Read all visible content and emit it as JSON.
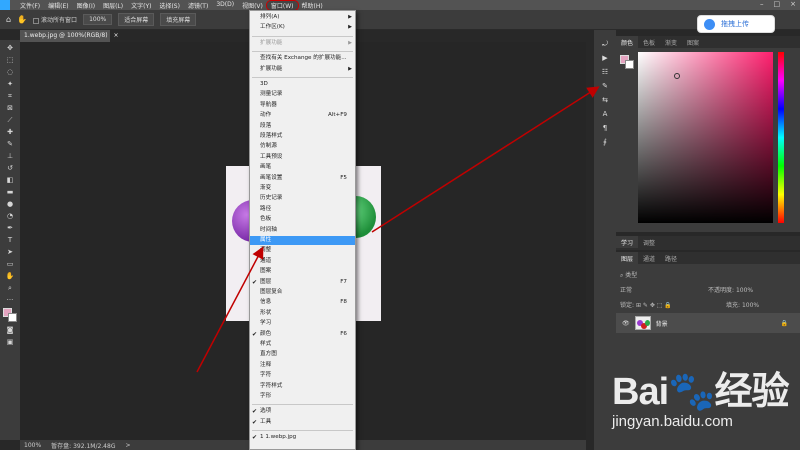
{
  "menubar": {
    "items": [
      "文件(F)",
      "编辑(E)",
      "图像(I)",
      "图层(L)",
      "文字(Y)",
      "选择(S)",
      "滤镜(T)",
      "3D(D)",
      "视图(V)",
      "窗口(W)",
      "帮助(H)"
    ],
    "active_index": 9
  },
  "options_bar": {
    "scroll_all_label": "滚动所有窗口",
    "zoom_value": "100%",
    "fit_screen": "适合屏幕",
    "fill_screen": "填充屏幕"
  },
  "document": {
    "tab_title": "1.webp.jpg @ 100%(RGB/8)",
    "close": "×"
  },
  "status": {
    "zoom": "100%",
    "scratch": "暂存盘: 392.1M/2.48G",
    "arrow": ">"
  },
  "upload_button": {
    "label": "拖拽上传"
  },
  "color_panel": {
    "tabs": [
      "颜色",
      "色板",
      "渐变",
      "图案"
    ]
  },
  "learn_panel": {
    "tabs": [
      "学习",
      "调整"
    ]
  },
  "layers_panel": {
    "tabs": [
      "图层",
      "通道",
      "路径"
    ],
    "kind_label": "类型",
    "blend_mode": "正常",
    "opacity_label": "不透明度:",
    "opacity_value": "100%",
    "lock_label": "锁定:",
    "fill_label": "填充:",
    "fill_value": "100%",
    "layer_name": "背景"
  },
  "window_menu": {
    "items": [
      {
        "label": "排列(A)",
        "arrow": true
      },
      {
        "label": "工作区(K)",
        "arrow": true
      },
      {
        "sep": true
      },
      {
        "label": "扩展功能",
        "arrow": true,
        "disabled": true
      },
      {
        "sep": true
      },
      {
        "label": "查找有关 Exchange 的扩展功能..."
      },
      {
        "label": "扩展功能",
        "arrow": true
      },
      {
        "sep": true
      },
      {
        "label": "3D"
      },
      {
        "label": "测量记录"
      },
      {
        "label": "导航器"
      },
      {
        "label": "动作",
        "shortcut": "Alt+F9"
      },
      {
        "label": "段落"
      },
      {
        "label": "段落样式"
      },
      {
        "label": "仿制源"
      },
      {
        "label": "工具预设"
      },
      {
        "label": "画笔"
      },
      {
        "label": "画笔设置",
        "shortcut": "F5"
      },
      {
        "label": "渐变"
      },
      {
        "label": "历史记录"
      },
      {
        "label": "路径"
      },
      {
        "label": "色板"
      },
      {
        "label": "时间轴"
      },
      {
        "label": "属性",
        "highlighted": true
      },
      {
        "label": "调整"
      },
      {
        "label": "通道"
      },
      {
        "label": "图案"
      },
      {
        "label": "图层",
        "shortcut": "F7",
        "checked": true
      },
      {
        "label": "图层复合"
      },
      {
        "label": "信息",
        "shortcut": "F8"
      },
      {
        "label": "形状"
      },
      {
        "label": "学习"
      },
      {
        "label": "颜色",
        "shortcut": "F6",
        "checked": true
      },
      {
        "label": "样式"
      },
      {
        "label": "直方图"
      },
      {
        "label": "注释"
      },
      {
        "label": "字符"
      },
      {
        "label": "字符样式"
      },
      {
        "label": "字形"
      },
      {
        "sep": true
      },
      {
        "label": "选项",
        "checked": true
      },
      {
        "label": "工具",
        "checked": true
      },
      {
        "sep": true
      },
      {
        "label": "1 1.webp.jpg",
        "checked": true
      }
    ]
  },
  "watermark": {
    "logo": "Bai🐾经验",
    "url": "jingyan.baidu.com"
  },
  "colors": {
    "foreground": "#e4a4c0",
    "highlight": "#3d99f5",
    "annotation_red": "#c00000"
  }
}
